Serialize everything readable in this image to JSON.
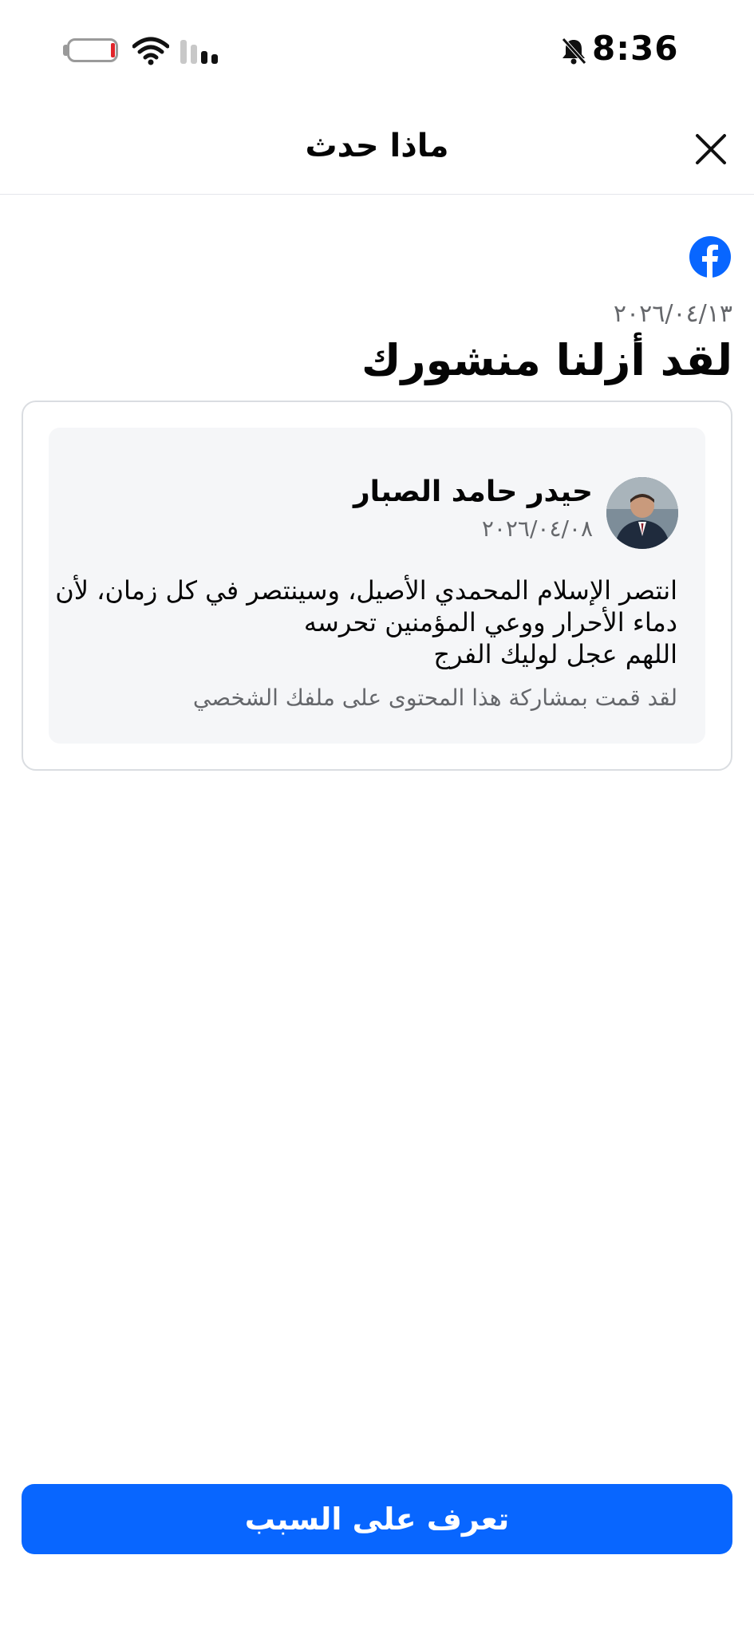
{
  "status_bar": {
    "time": "8:36",
    "battery_icon": "battery-low-icon",
    "wifi_icon": "wifi-icon",
    "signal_icon": "cellular-signal-icon",
    "silent_icon": "bell-slash-icon"
  },
  "header": {
    "title": "ماذا حدث",
    "close_icon": "close-icon"
  },
  "notice": {
    "brand_icon": "facebook-icon",
    "date": "٢٠٢٦/٠٤/١٣",
    "title": "لقد أزلنا منشورك"
  },
  "post": {
    "author": "حيدر حامد الصبار",
    "date": "٢٠٢٦/٠٤/٠٨",
    "lines": [
      "انتصر الإسلام المحمدي الأصيل، وسينتصر في كل زمان، لأن",
      "دماء الأحرار ووعي المؤمنين تحرسه",
      "اللهم عجل لوليك الفرج"
    ],
    "share_note": "لقد قمت بمشاركة هذا المحتوى على ملفك الشخصي"
  },
  "button": {
    "label": "تعرف على السبب"
  },
  "colors": {
    "brand_blue": "#0866ff",
    "secondary_text": "#65676b",
    "card_bg": "#f5f6f8"
  }
}
